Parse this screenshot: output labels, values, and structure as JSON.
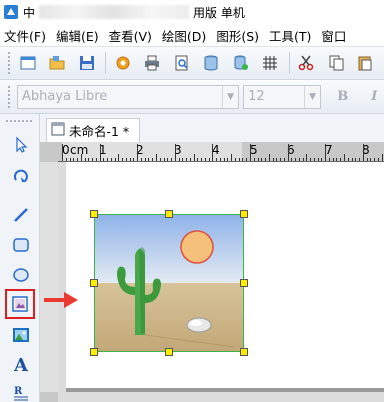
{
  "title": {
    "prefix": "中",
    "suffix": "用版 单机"
  },
  "menu": [
    {
      "label": "文件(F)"
    },
    {
      "label": "编辑(E)"
    },
    {
      "label": "查看(V)"
    },
    {
      "label": "绘图(D)"
    },
    {
      "label": "图形(S)"
    },
    {
      "label": "工具(T)"
    },
    {
      "label": "窗口"
    }
  ],
  "font_toolbar": {
    "font_name": "Abhaya Libre",
    "font_size": "12",
    "bold_label": "B",
    "italic_label": "I"
  },
  "document_tab": {
    "label": "未命名-1 *"
  },
  "ruler": {
    "unit": "cm",
    "numbers": [
      "0",
      "1",
      "2",
      "3",
      "4",
      "5",
      "6",
      "7",
      "8"
    ]
  },
  "tools": {
    "text_label": "A"
  },
  "colors": {
    "selection_border": "#3cb34a",
    "handle_fill": "#ffee00",
    "highlight_red": "#e02020"
  }
}
